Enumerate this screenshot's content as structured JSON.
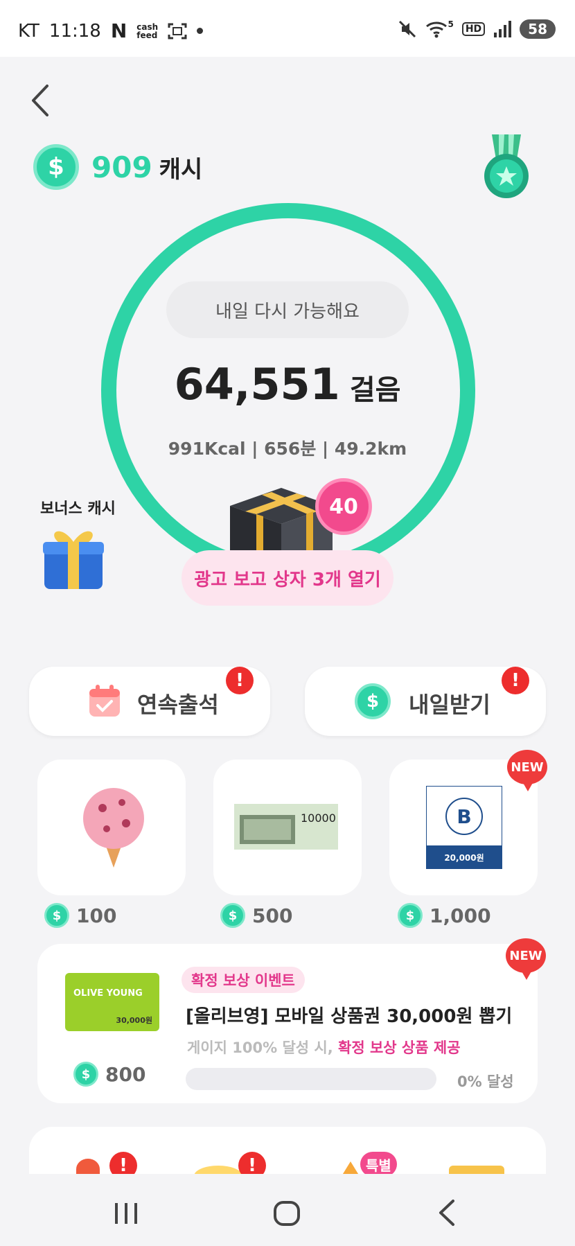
{
  "status_bar": {
    "carrier": "KT",
    "time": "11:18",
    "app_n": "N",
    "cashfeed_line1": "cash",
    "cashfeed_line2": "feed",
    "network": "5",
    "hd": "HD",
    "battery": "58"
  },
  "wallet": {
    "amount": "909",
    "unit": "캐시",
    "coin_symbol": "$"
  },
  "walk": {
    "pill": "내일 다시 가능해요",
    "steps": "64,551",
    "steps_unit": "걸음",
    "stats": "991Kcal  |  656분  |   49.2km",
    "box_count": "40",
    "ad_button": "광고 보고 상자 3개 열기"
  },
  "bonus": {
    "label": "보너스 캐시"
  },
  "actions": [
    {
      "label": "연속출석",
      "alert": "!"
    },
    {
      "label": "내일받기",
      "alert": "!",
      "coin": "$"
    }
  ],
  "rewards": [
    {
      "price": "100"
    },
    {
      "price": "500",
      "voucher_value": "10000"
    },
    {
      "price": "1,000",
      "badge": "NEW",
      "voucher_value": "20,000원"
    }
  ],
  "event": {
    "badge": "NEW",
    "tag": "확정 보상 이벤트",
    "title": "[올리브영] 모바일 상품권 30,000원 뽑기",
    "sub_plain": "게이지 100% 달성 시, ",
    "sub_highlight": "확정 보상 상품 제공",
    "price": "800",
    "progress_percent": 0,
    "progress_text": "0% 달성",
    "card_logo": "OLIVE YOUNG",
    "card_price": "30,000원"
  },
  "bottom_row": {
    "special_badge": "특별",
    "alert": "!"
  },
  "colors": {
    "accent": "#2ed3a6",
    "pink": "#e2378b",
    "alert": "#ed2d2d"
  }
}
